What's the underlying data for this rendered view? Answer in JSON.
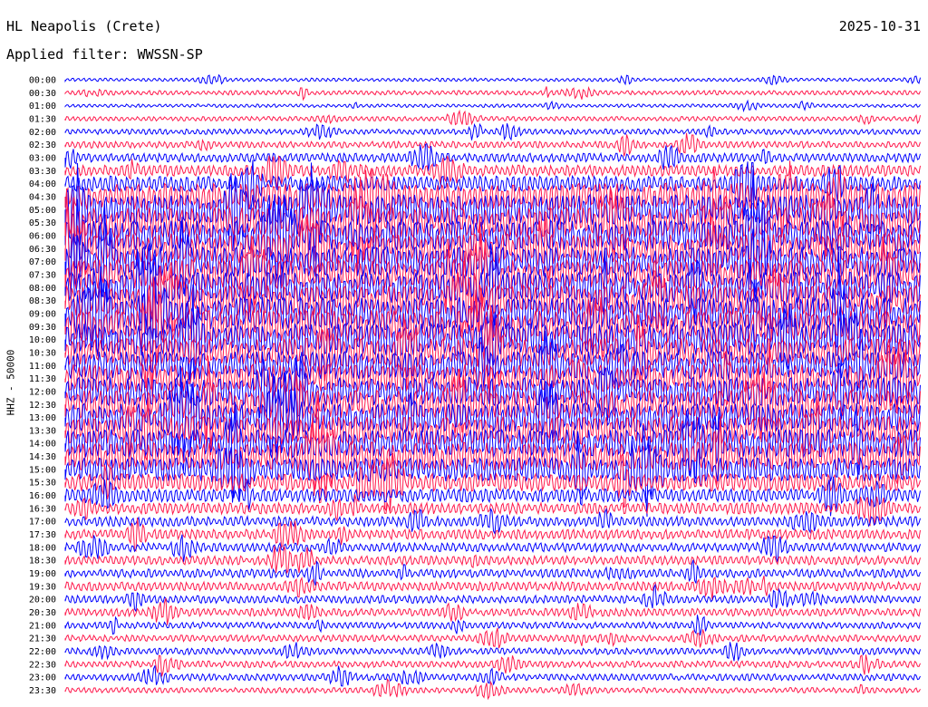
{
  "header": {
    "station": "HL Neapolis (Crete)",
    "date": "2025-10-31",
    "filter": "Applied filter: WWSSN-SP"
  },
  "channel_label": "HHZ - 50000",
  "colors": {
    "line_a": "#0000ff",
    "line_b": "#ff1a4d",
    "background": "#ffffff"
  },
  "chart_data": {
    "type": "line",
    "subtype": "helicorder",
    "ylabel": "HHZ - 50000",
    "tick_labels": [
      "00:00",
      "00:30",
      "01:00",
      "01:30",
      "02:00",
      "02:30",
      "03:00",
      "03:30",
      "04:00",
      "04:30",
      "05:00",
      "05:30",
      "06:00",
      "06:30",
      "07:00",
      "07:30",
      "08:00",
      "08:30",
      "09:00",
      "09:30",
      "10:00",
      "10:30",
      "11:00",
      "11:30",
      "12:00",
      "12:30",
      "13:00",
      "13:30",
      "14:00",
      "14:30",
      "15:00",
      "15:30",
      "16:00",
      "16:30",
      "17:00",
      "17:30",
      "18:00",
      "18:30",
      "19:00",
      "19:30",
      "20:00",
      "20:30",
      "21:00",
      "21:30",
      "22:00",
      "22:30",
      "23:00",
      "23:30"
    ],
    "trace_colors": [
      "blue",
      "red"
    ],
    "relative_amplitude": [
      0.3,
      0.4,
      0.3,
      0.4,
      0.5,
      0.6,
      0.8,
      1.0,
      1.4,
      2.5,
      2.8,
      2.8,
      2.8,
      2.8,
      2.8,
      2.8,
      2.8,
      2.8,
      3.0,
      3.0,
      3.0,
      2.6,
      2.6,
      2.6,
      2.6,
      2.6,
      2.6,
      2.6,
      2.6,
      2.6,
      2.2,
      1.6,
      1.2,
      1.0,
      0.9,
      0.9,
      0.8,
      0.8,
      0.8,
      0.8,
      0.7,
      0.7,
      0.6,
      0.6,
      0.6,
      0.6,
      0.6,
      0.5
    ]
  }
}
